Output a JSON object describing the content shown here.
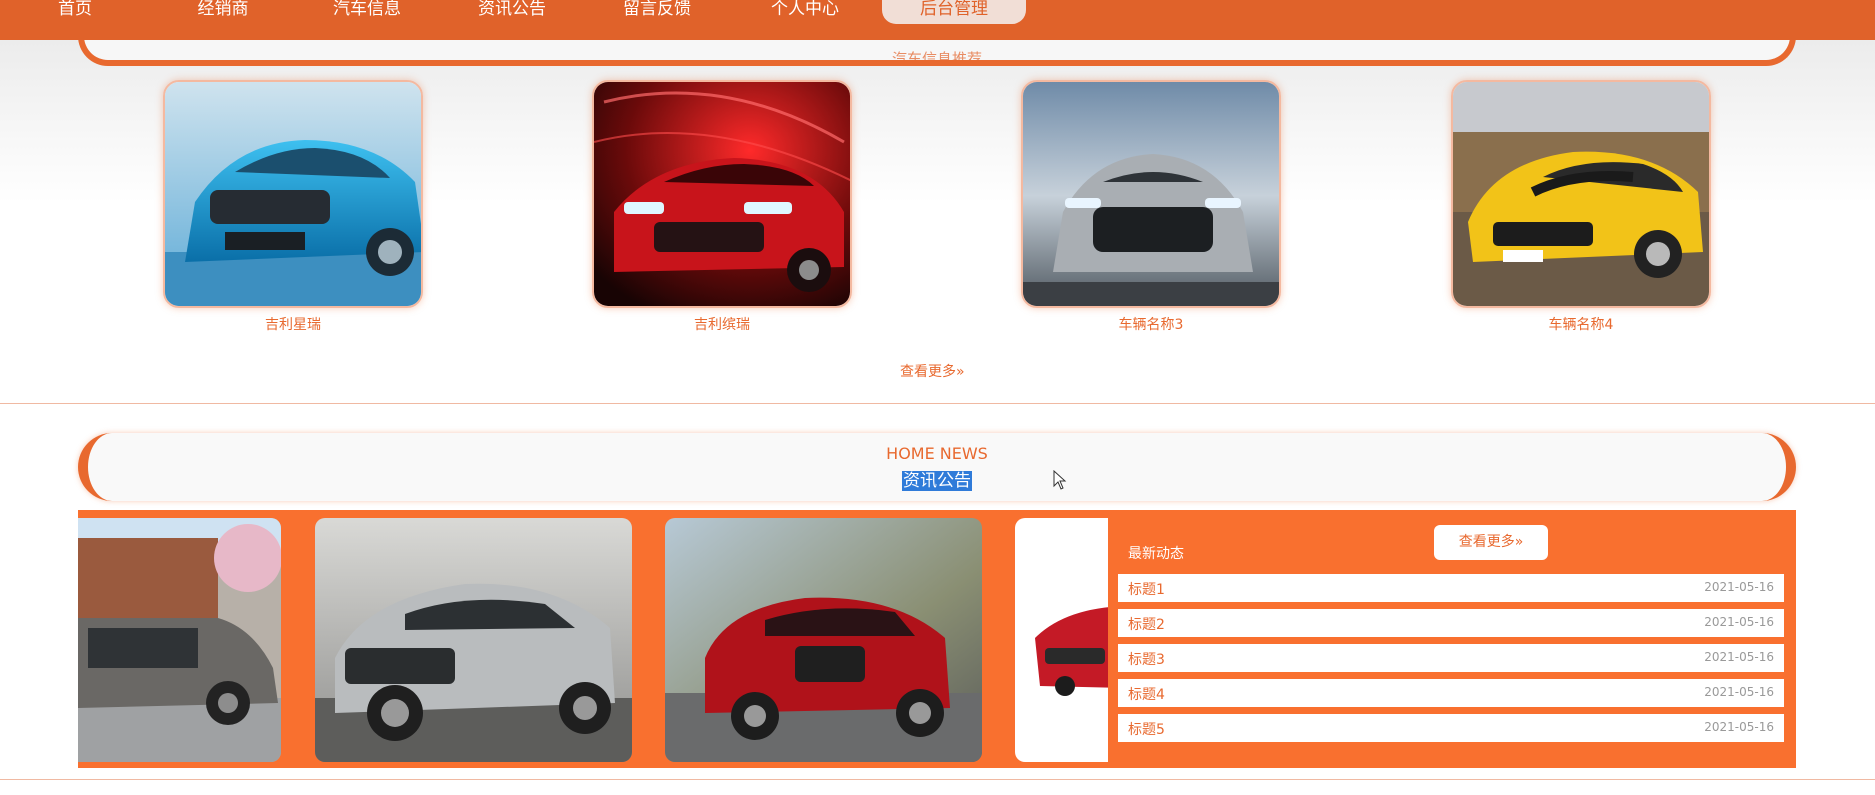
{
  "nav": {
    "items": [
      {
        "label": "首页"
      },
      {
        "label": "经销商"
      },
      {
        "label": "汽车信息"
      },
      {
        "label": "资讯公告"
      },
      {
        "label": "留言反馈"
      },
      {
        "label": "个人中心"
      },
      {
        "label": "后台管理"
      }
    ]
  },
  "recommend": {
    "title": "汽车信息推荐",
    "cars": [
      {
        "name": "吉利星瑞"
      },
      {
        "name": "吉利缤瑞"
      },
      {
        "name": "车辆名称3"
      },
      {
        "name": "车辆名称4"
      }
    ],
    "more_label": "查看更多»"
  },
  "news": {
    "subtitle": "HOME NEWS",
    "title": "资讯公告",
    "panel_title": "最新动态",
    "more_label": "查看更多»",
    "items": [
      {
        "title": "标题1",
        "date": "2021-05-16"
      },
      {
        "title": "标题2",
        "date": "2021-05-16"
      },
      {
        "title": "标题3",
        "date": "2021-05-16"
      },
      {
        "title": "标题4",
        "date": "2021-05-16"
      },
      {
        "title": "标题5",
        "date": "2021-05-16"
      }
    ]
  },
  "colors": {
    "accent": "#e8692f",
    "nav_bg": "#e0622a",
    "news_band": "#f9702f",
    "selection": "#2f7bd9"
  }
}
